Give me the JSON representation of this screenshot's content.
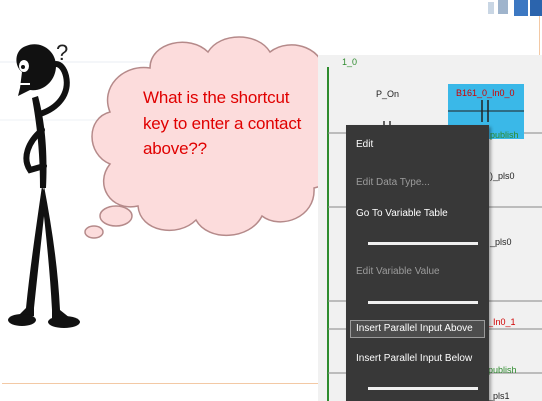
{
  "bubble": {
    "lines": [
      "What  is the shortcut",
      "key to enter a contact",
      "above??"
    ]
  },
  "figure": {
    "question_mark": "?"
  },
  "ladder": {
    "rung_label": "1_0",
    "var_p_on": "P_On",
    "var_contact": "B161_0_In0_0",
    "publish_top": "publish",
    "pls0_a": ")_pls0",
    "pls0_b": "_pls0",
    "in0_1": "_In0_1",
    "publish_bottom": "publish",
    "pls1": "_pls1"
  },
  "context_menu": {
    "items": [
      {
        "label": "Edit",
        "disabled": false
      },
      {
        "label": "Edit Data Type...",
        "disabled": true
      },
      {
        "label": "Go To Variable Table",
        "disabled": false
      },
      {
        "label": "Edit Variable Value",
        "disabled": true
      },
      {
        "label": "Insert Parallel Input Above",
        "disabled": false,
        "highlighted": true
      },
      {
        "label": "Insert Parallel Input Below",
        "disabled": false
      }
    ]
  },
  "colors": {
    "bubble_fill": "#fcdcdc",
    "bubble_text": "#e00000",
    "menu_bg": "#383838",
    "contact_highlight": "#3ab8e8",
    "ladder_green": "#2e8b2e"
  }
}
